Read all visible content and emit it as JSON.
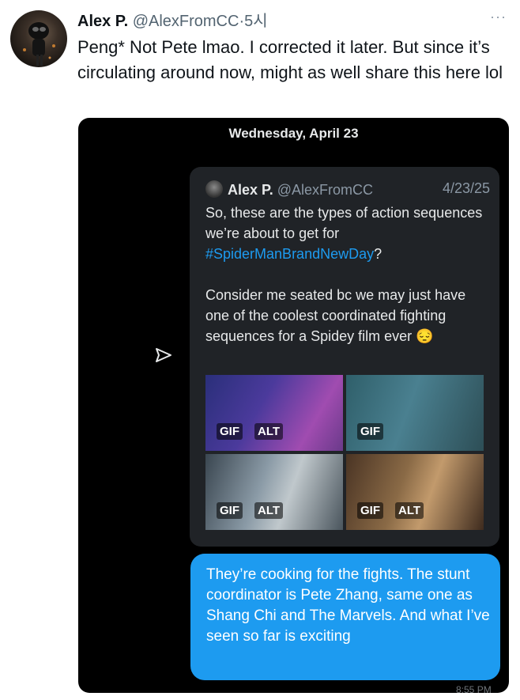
{
  "tweet": {
    "author_name": "Alex P.",
    "author_handle": "@AlexFromCC",
    "separator": "·",
    "time": "5시",
    "more_label": "···",
    "text": "Peng* Not Pete lmao. I corrected it later. But since it’s circulating around now, might as well share this here lol"
  },
  "screenshot": {
    "date_header": "Wednesday, April 23",
    "quoted_tweet": {
      "author_name": "Alex P.",
      "author_handle": "@AlexFromCC",
      "date": "4/23/25",
      "text_part1": "So, these are the types of action sequences we’re about to get for ",
      "hashtag": "#SpiderManBrandNewDay",
      "text_part2": "?",
      "text_para2": "Consider me seated bc we may just have one of the coolest coordinated fighting sequences for a Spidey film ever",
      "emoji": "😔",
      "media": [
        {
          "gif_label": "GIF",
          "alt_label": "ALT"
        },
        {
          "gif_label": "GIF",
          "alt_label": ""
        },
        {
          "gif_label": "GIF",
          "alt_label": "ALT"
        },
        {
          "gif_label": "GIF",
          "alt_label": "ALT"
        }
      ]
    },
    "message": "They’re cooking for the fights. The stunt coordinator is Pete Zhang, same one as Shang Chi and The Marvels. And what I’ve seen so far is exciting",
    "timestamp_partial": "8:55 PM"
  }
}
